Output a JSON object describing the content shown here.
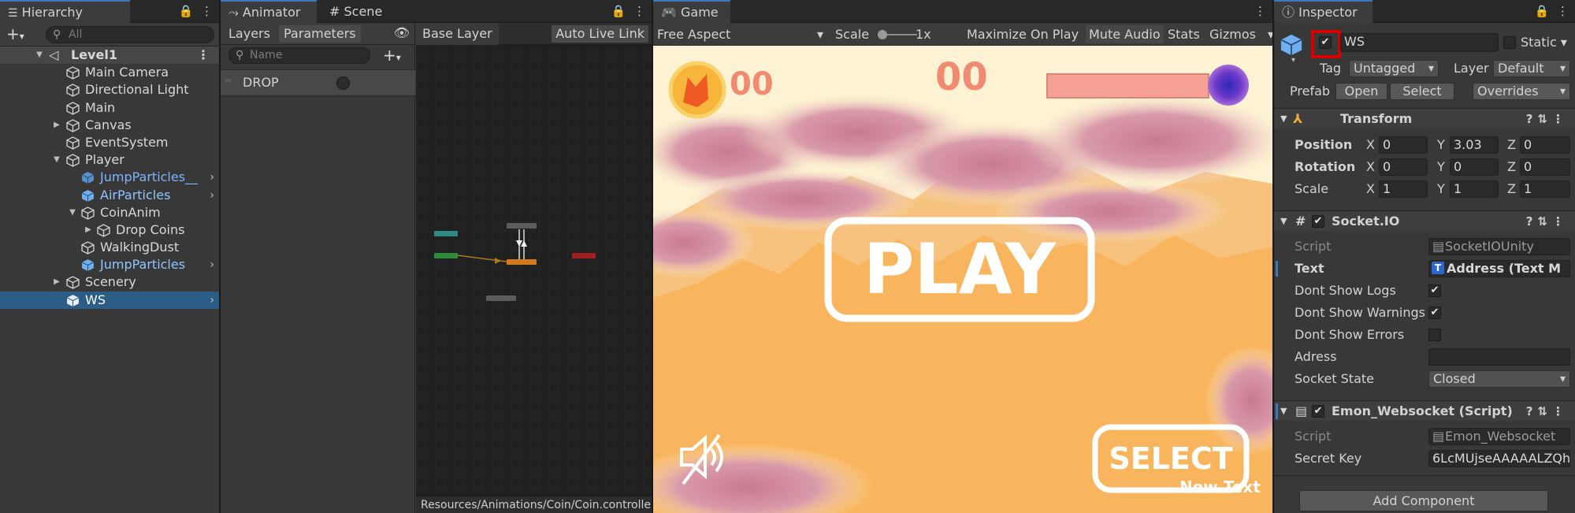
{
  "colors": {
    "selection": "#2c5d87",
    "accent_tab": "#3a79bb",
    "highlight_box": "#d40000",
    "game_sky": "#fdf2d3",
    "game_ground": "#f9b55d",
    "game_score": "#f08b72"
  },
  "hierarchy": {
    "tab_title": "Hierarchy",
    "search_placeholder": "All",
    "items": [
      {
        "label": "Level1",
        "icon": "unity-scene-icon"
      },
      {
        "label": "Main Camera",
        "icon": "gameobject-cube-icon"
      },
      {
        "label": "Directional Light",
        "icon": "gameobject-cube-icon"
      },
      {
        "label": "Main",
        "icon": "gameobject-cube-icon"
      },
      {
        "label": "Canvas",
        "icon": "gameobject-cube-icon"
      },
      {
        "label": "EventSystem",
        "icon": "gameobject-cube-icon"
      },
      {
        "label": "Player",
        "icon": "gameobject-cube-icon"
      },
      {
        "label": "JumpParticles__",
        "icon": "prefab-cube-icon"
      },
      {
        "label": "AirParticles",
        "icon": "prefab-cube-icon"
      },
      {
        "label": "CoinAnim",
        "icon": "gameobject-cube-icon"
      },
      {
        "label": "Drop Coins",
        "icon": "gameobject-cube-icon"
      },
      {
        "label": "WalkingDust",
        "icon": "gameobject-cube-icon"
      },
      {
        "label": "JumpParticles",
        "icon": "prefab-cube-icon"
      },
      {
        "label": "Scenery",
        "icon": "gameobject-cube-icon"
      },
      {
        "label": "WS",
        "icon": "prefab-cube-icon"
      }
    ]
  },
  "animator": {
    "tab_title": "Animator",
    "scene_tab": "Scene",
    "layers_tab": "Layers",
    "parameters_tab": "Parameters",
    "param_search_placeholder": "Name",
    "parameter_name": "DROP",
    "breadcrumb": "Base Layer",
    "auto_live_link": "Auto Live Link",
    "controller_path": "Resources/Animations/Coin/Coin.controller"
  },
  "game": {
    "tab_title": "Game",
    "aspect": "Free Aspect",
    "scale_label": "Scale",
    "scale_value": "1x",
    "maximize_on_play": "Maximize On Play",
    "mute_audio": "Mute Audio",
    "stats": "Stats",
    "gizmos": "Gizmos",
    "coin_count": "00",
    "score": "00",
    "play_label": "PLAY",
    "select_label": "SELECT",
    "new_text": "New Text"
  },
  "inspector": {
    "tab_title": "Inspector",
    "object_name": "WS",
    "active": true,
    "static_label": "Static",
    "tag_label": "Tag",
    "tag_value": "Untagged",
    "layer_label": "Layer",
    "layer_value": "Default",
    "prefab_label": "Prefab",
    "open_button": "Open",
    "select_button": "Select",
    "overrides": "Overrides",
    "transform": {
      "title": "Transform",
      "position_label": "Position",
      "rotation_label": "Rotation",
      "scale_label": "Scale",
      "position": {
        "x": "0",
        "y": "3.03",
        "z": "0"
      },
      "rotation": {
        "x": "0",
        "y": "0",
        "z": "0"
      },
      "scale": {
        "x": "1",
        "y": "1",
        "z": "1"
      }
    },
    "socketio": {
      "title": "Socket.IO",
      "script_label": "Script",
      "script_value": "SocketIOUnity",
      "text_label": "Text",
      "text_value": "Address (Text M",
      "dont_show_logs_label": "Dont Show Logs",
      "dont_show_logs": true,
      "dont_show_warnings_label": "Dont Show Warnings",
      "dont_show_warnings": true,
      "dont_show_errors_label": "Dont Show Errors",
      "dont_show_errors": false,
      "adress_label": "Adress",
      "adress_value": "",
      "socket_state_label": "Socket State",
      "socket_state_value": "Closed"
    },
    "emon": {
      "title": "Emon_Websocket (Script)",
      "script_label": "Script",
      "script_value": "Emon_Websocket",
      "secret_key_label": "Secret Key",
      "secret_key_value": "6LcMUjseAAAAALZQh"
    },
    "add_component": "Add Component"
  }
}
